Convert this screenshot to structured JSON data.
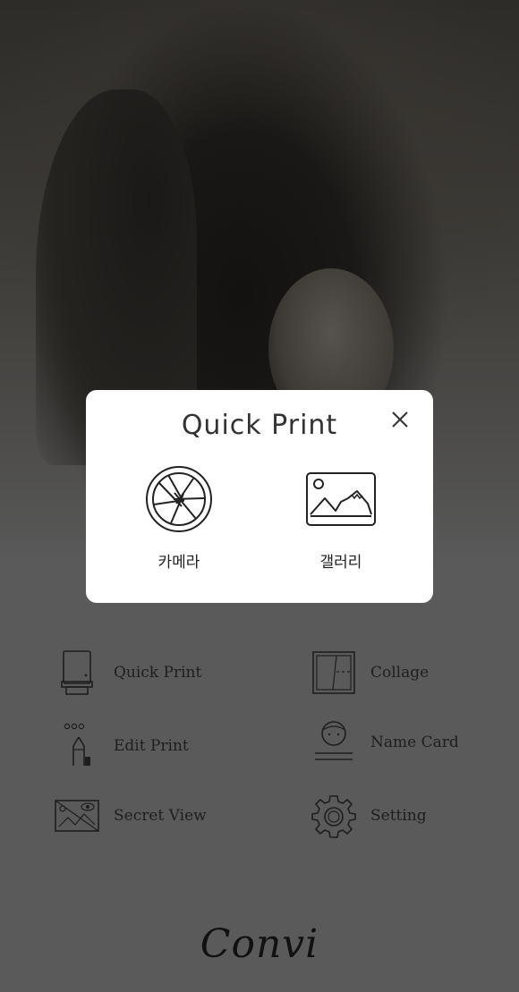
{
  "dialog": {
    "title": "Quick Print",
    "options": [
      {
        "label": "카메라",
        "icon": "camera-aperture-icon"
      },
      {
        "label": "갤러리",
        "icon": "gallery-image-icon"
      }
    ]
  },
  "menu": {
    "items": [
      {
        "label": "Quick Print",
        "icon": "printer-icon"
      },
      {
        "label": "Collage",
        "icon": "collage-icon"
      },
      {
        "label": "Edit Print",
        "icon": "pen-edit-icon"
      },
      {
        "label": "Name Card",
        "icon": "name-card-icon"
      },
      {
        "label": "Secret View",
        "icon": "secret-view-icon"
      },
      {
        "label": "Setting",
        "icon": "gear-icon"
      }
    ]
  },
  "brand": {
    "logo_text": "Convi"
  },
  "colors": {
    "background": "#5a5a5a",
    "dialog": "#ffffff",
    "icon_stroke": "#1e1e1e"
  }
}
